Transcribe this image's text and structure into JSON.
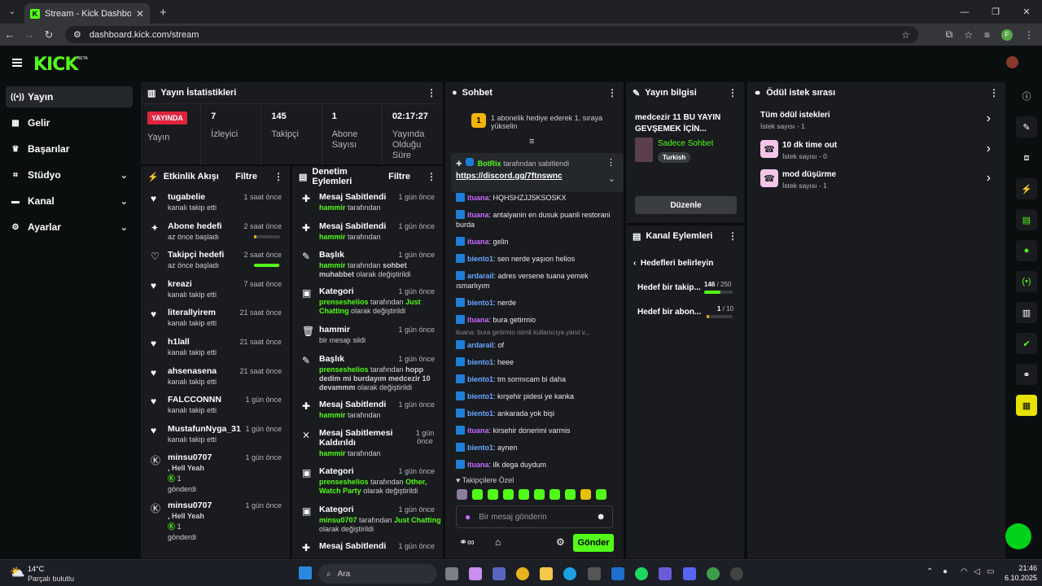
{
  "browser": {
    "tab_title": "Stream - Kick Dashboard",
    "tab_favicon": "K",
    "close_tab": "✕",
    "new_tab": "+",
    "url": "dashboard.kick.com/stream",
    "profile_initial": "F"
  },
  "header": {
    "logo": "KICK",
    "beta": "BETA"
  },
  "sidebar": {
    "items": [
      {
        "label": "Yayın",
        "icon": "broadcast-icon"
      },
      {
        "label": "Gelir",
        "icon": "revenue-icon"
      },
      {
        "label": "Başarılar",
        "icon": "trophy-icon"
      },
      {
        "label": "Stüdyo",
        "icon": "studio-icon"
      },
      {
        "label": "Kanal",
        "icon": "channel-icon"
      },
      {
        "label": "Ayarlar",
        "icon": "gear-icon"
      }
    ]
  },
  "stats": {
    "title": "Yayın İstatistikleri",
    "live_badge": "YAYINDA",
    "live_label": "Yayın",
    "viewers_value": "7",
    "viewers_label": "İzleyici",
    "followers_value": "145",
    "followers_label": "Takipçi",
    "subs_value": "1",
    "subs_label": "Abone Sayısı",
    "uptime_value": "02:17:27",
    "uptime_label": "Yayında Olduğu Süre"
  },
  "activity": {
    "title": "Etkinlik Akışı",
    "filter": "Filtre",
    "rows": [
      {
        "name": "tugabelie",
        "sub": "kanalı takip etti",
        "time": "1 saat önce"
      },
      {
        "name": "Abone hedefi",
        "sub": "az önce başladı",
        "time": "2 saat önce"
      },
      {
        "name": "Takipçi hedefi",
        "sub": "az önce başladı",
        "time": "2 saat önce"
      },
      {
        "name": "kreazi",
        "sub": "kanalı takip etti",
        "time": "7 saat önce"
      },
      {
        "name": "literallyirem",
        "sub": "kanalı takip etti",
        "time": "21 saat önce"
      },
      {
        "name": "h1lall",
        "sub": "kanalı takip etti",
        "time": "21 saat önce"
      },
      {
        "name": "ahsenasena",
        "sub": "kanalı takip etti",
        "time": "21 saat önce"
      },
      {
        "name": "FALCCONNN",
        "sub": "kanalı takip etti",
        "time": "1 gün önce"
      },
      {
        "name": "MustafunNyga_31",
        "sub": "kanalı takip etti",
        "time": "1 gün önce"
      }
    ],
    "gift1": {
      "name": "minsu0707",
      "sub1": ", Hell Yeah",
      "count": "1",
      "sub2": "gönderdi",
      "time": "1 gün önce"
    },
    "gift2": {
      "name": "minsu0707",
      "sub1": ", Hell Yeah",
      "count": "1",
      "sub2": "gönderdi",
      "time": "1 gün önce"
    },
    "sub_goal_progress": 0.1,
    "follow_goal_progress": 0.97
  },
  "moderation": {
    "title": "Denetim Eylemleri",
    "filter": "Filtre",
    "r1": {
      "title": "Mesaj Sabitlendi",
      "user": "hammir",
      "rest": " tarafından",
      "time": "1 gün önce"
    },
    "r2": {
      "title": "Mesaj Sabitlendi",
      "user": "hammir",
      "rest": " tarafından",
      "time": "1 gün önce"
    },
    "r3": {
      "title": "Başlık",
      "user": "hammir",
      "rest": " tarafından ",
      "bold": "sohbet muhabbet",
      "rest2": " olarak değiştirildi",
      "time": "1 gün önce"
    },
    "r4": {
      "title": "Kategori",
      "user": "prenseshelios",
      "rest": " tarafından ",
      "bold": "Just Chatting",
      "rest2": " olarak değiştirildi",
      "time": "1 gün önce"
    },
    "r5": {
      "title": "hammir",
      "sub": "bir mesajı sildi",
      "time": "1 gün önce"
    },
    "r6": {
      "title": "Başlık",
      "user": "prenseshelios",
      "rest": " tarafından ",
      "bold": "hopp dedim mi burdayım medcezir 10 devammm",
      "rest2": " olarak değiştirildi",
      "time": "1 gün önce"
    },
    "r7": {
      "title": "Mesaj Sabitlendi",
      "user": "hammir",
      "rest": " tarafından",
      "time": "1 gün önce"
    },
    "r8": {
      "title": "Mesaj Sabitlemesi Kaldırıldı",
      "user": "hammir",
      "rest": " tarafından",
      "time": "1 gün önce"
    },
    "r9": {
      "title": "Kategori",
      "user": "prenseshelios",
      "rest": " tarafından ",
      "bold": "Other, Watch Party",
      "rest2": " olarak değiştirildi",
      "time": "1 gün önce"
    },
    "r10": {
      "title": "Kategori",
      "user": "minsu0707",
      "rest": " tarafından ",
      "bold": "Just Chatting",
      "rest2": " olarak değiştirildi",
      "time": "1 gün önce"
    },
    "r11": {
      "title": "Mesaj Sabitlendi",
      "time": "1 gün önce"
    }
  },
  "chat": {
    "title": "Sohbet",
    "gift_rank": "1",
    "gift_text": "1 abonelik hediye ederek 1. sıraya yükselin",
    "pinned_user": "BotRix",
    "pinned_by": "tarafından sabitlendi",
    "pinned_link": "https://discord.gg/7ftnswnc",
    "messages": [
      {
        "user": "ituana",
        "text": ": HQHSHZJJSKSOSKX",
        "color": "#c86bff"
      },
      {
        "user": "ituana",
        "text": ": antalyanin en dusuk puanli restorani burda",
        "color": "#c86bff"
      },
      {
        "user": "ituana",
        "text": ": gelin",
        "color": "#c86bff"
      },
      {
        "user": "biento1",
        "text": ": sen nerde yaşıon helios",
        "color": "#6aa8ff"
      },
      {
        "user": "ardarail",
        "text": ": adres versene tuana yemek ısmarlıyım",
        "color": "#6aa8ff"
      },
      {
        "user": "biento1",
        "text": ": nerde",
        "color": "#6aa8ff"
      },
      {
        "user": "ituana",
        "text": ": bura getirmio",
        "color": "#c86bff"
      }
    ],
    "reply_hint": "ituana: bura getirmio isimli kullanıcıya yanıt v...",
    "messages2": [
      {
        "user": "ardarail",
        "text": ": of",
        "color": "#6aa8ff"
      },
      {
        "user": "biento1",
        "text": ": heee",
        "color": "#6aa8ff"
      },
      {
        "user": "biento1",
        "text": ": tm sormıcam bi daha",
        "color": "#6aa8ff"
      },
      {
        "user": "biento1",
        "text": ": kırşehir pidesi ye kanka",
        "color": "#6aa8ff"
      },
      {
        "user": "biento1",
        "text": ": ankarada yok bişi",
        "color": "#6aa8ff"
      },
      {
        "user": "ituana",
        "text": ": kirsehir donerimi varmis",
        "color": "#c86bff"
      },
      {
        "user": "biento1",
        "text": ": aynen",
        "color": "#6aa8ff"
      },
      {
        "user": "ituana",
        "text": ": ilk dega duydum",
        "color": "#c86bff"
      }
    ],
    "followers_only": "♥ Takipçilere Özel",
    "placeholder": "Bir mesaj gönderin",
    "send": "Gönder"
  },
  "stream_info": {
    "title": "Yayın bilgisi",
    "stream_title": "medcezir 11 BU YAYIN GEVŞEMEK İÇİN...",
    "category": "Sadece Sohbet",
    "language": "Turkish",
    "edit": "Düzenle"
  },
  "channel_actions": {
    "title": "Kanal Eylemleri",
    "back": "Hedefleri belirleyin",
    "goal1_label": "Hedef bir takip...",
    "goal1_cur": "146",
    "goal1_total": " / 250",
    "goal1_progress": 0.584,
    "goal2_label": "Hedef bir abon...",
    "goal2_cur": "1",
    "goal2_total": " / 10",
    "goal2_progress": 0.1
  },
  "rewards": {
    "title": "Ödül istek sırası",
    "all_title": "Tüm ödül istekleri",
    "all_sub": "İstek sayısı - 1",
    "r1_title": "10 dk time out",
    "r1_sub": "İstek sayısı - 0",
    "r2_title": "mod düşürme",
    "r2_sub": "İstek sayısı - 1"
  },
  "taskbar": {
    "temp": "14°C",
    "weather": "Parçalı bulutlu",
    "search": "Ara",
    "time": "21:46",
    "date": "6.10.2025"
  },
  "colors": {
    "accent": "#53fc18",
    "live": "#e0243f",
    "panel": "#191b1f"
  }
}
